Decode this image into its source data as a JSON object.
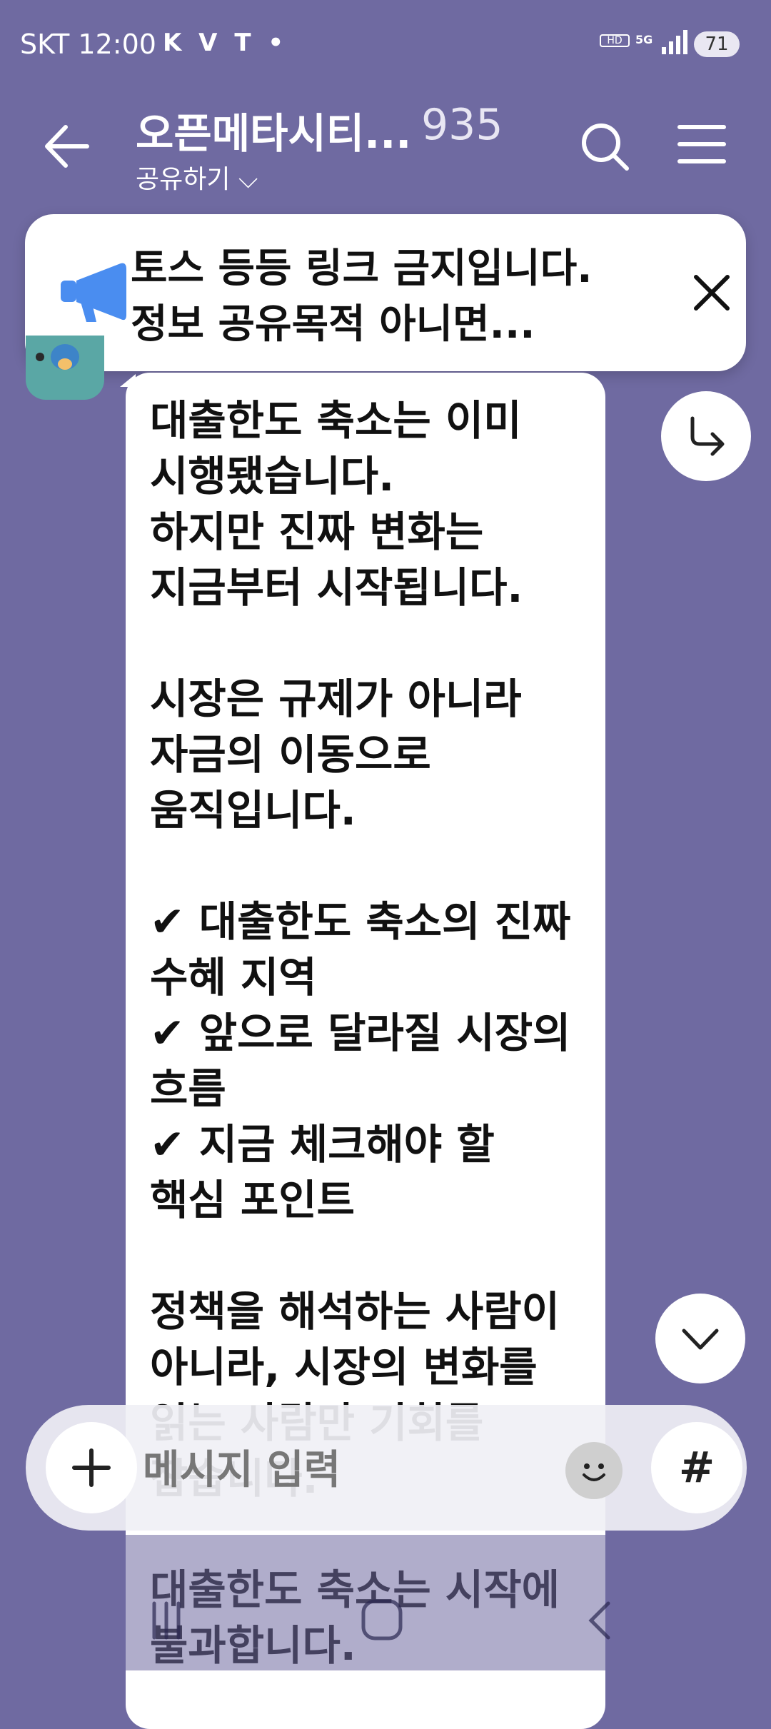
{
  "status_bar": {
    "carrier": "SKT",
    "time": "12:00",
    "app_icons": "K V T •",
    "hd_voice": "HD\nVoice",
    "network": "5G",
    "battery": "71"
  },
  "header": {
    "title": "오픈메타시티...",
    "member_count": "935",
    "share_label": "공유하기"
  },
  "notice": {
    "text": "토스 등등 링크 금지입니다.\n정보 공유목적 아니면..."
  },
  "message": {
    "text": "대출한도 축소는 이미\n시행됐습니다.\n하지만 진짜 변화는\n지금부터 시작됩니다.\n\n시장은 규제가 아니라\n자금의 이동으로\n움직입니다.\n\n✔ 대출한도 축소의 진짜\n수혜 지역\n✔ 앞으로 달라질 시장의\n흐름\n✔ 지금 체크해야 할\n핵심 포인트\n\n정책을 해석하는 사람이\n아니라, 시장의 변화를\n읽는 사람만 기회를\n잡습니다.\n\n대출한도 축소는 시작에\n불과합니다."
  },
  "composer": {
    "placeholder": "메시지 입력",
    "hash_label": "#"
  },
  "colors": {
    "background": "#6f6aa1",
    "bubble": "#ffffff",
    "accent_icon": "#4a8df0"
  }
}
